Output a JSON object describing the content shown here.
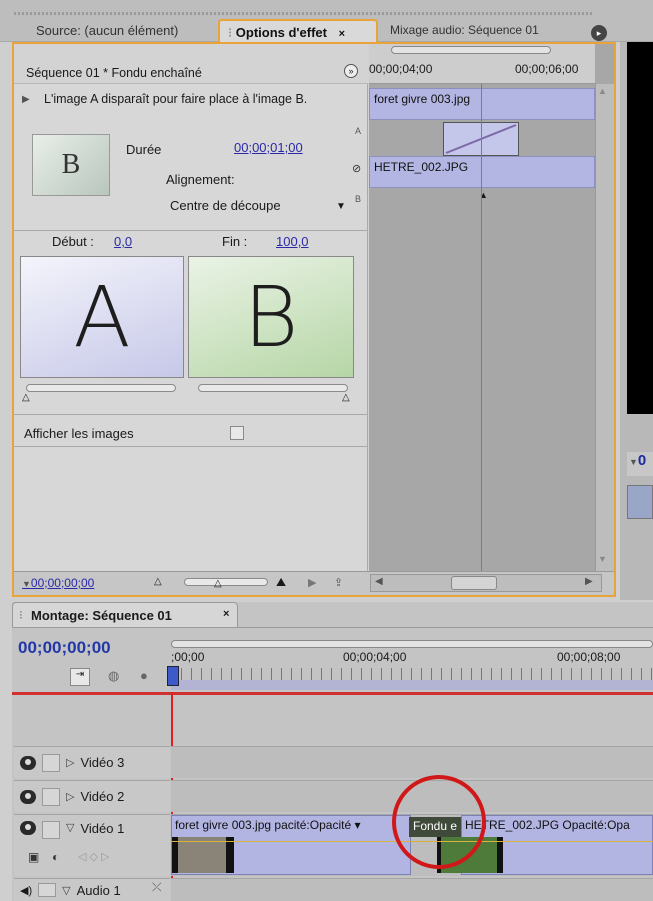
{
  "top_tabs": {
    "source": "Source: (aucun élément)",
    "effect_options": "Options d'effet",
    "audio_mixer": "Mixage audio: Séquence 01",
    "close_glyph": "×"
  },
  "effect_panel": {
    "sequence_title": "Séquence 01 * Fondu enchaîné",
    "description": "L'image A disparaît pour faire place à l'image B.",
    "duration_label": "Durée",
    "duration_value": "00;00;01;00",
    "alignment_label": "Alignement:",
    "alignment_value": "Centre de découpe",
    "start_label": "Début :",
    "start_value": "0,0",
    "end_label": "Fin :",
    "end_value": "100,0",
    "image_a_letter": "A",
    "image_b_letter": "B",
    "thumb_letter": "B",
    "show_images_label": "Afficher les images",
    "track_a_marker": "A",
    "track_b_marker": "B",
    "current_time": "00;00;00;00",
    "mini_timeline": {
      "time1": "00;00;04;00",
      "time2": "00;00;06;00",
      "clip_a": "foret givre 003.jpg",
      "clip_b": "HETRE_002.JPG"
    }
  },
  "monitor_side": {
    "time_partial": "0"
  },
  "timeline": {
    "tab_title": "Montage: Séquence 01",
    "current_time": "00;00;00;00",
    "ruler_labels": [
      ";00;00",
      "00;00;04;00",
      "00;00;08;00"
    ],
    "tracks": [
      {
        "name": "Vidéo 3"
      },
      {
        "name": "Vidéo 2"
      },
      {
        "name": "Vidéo 1"
      },
      {
        "name": "Audio 1"
      }
    ],
    "video1_clips": {
      "clip_a": "foret givre 003.jpg",
      "clip_a_opacity": "pacité:Opacité",
      "transition": "Fondu e",
      "clip_b": "HETRE_002.JPG",
      "clip_b_opacity": "Opacité:Opa"
    }
  },
  "colors": {
    "focus_border": "#e8a33a",
    "clip_fill": "#b2b4e2",
    "playhead": "#e02020",
    "highlight_circle": "#d01818",
    "link_text": "#2a2aa8"
  }
}
